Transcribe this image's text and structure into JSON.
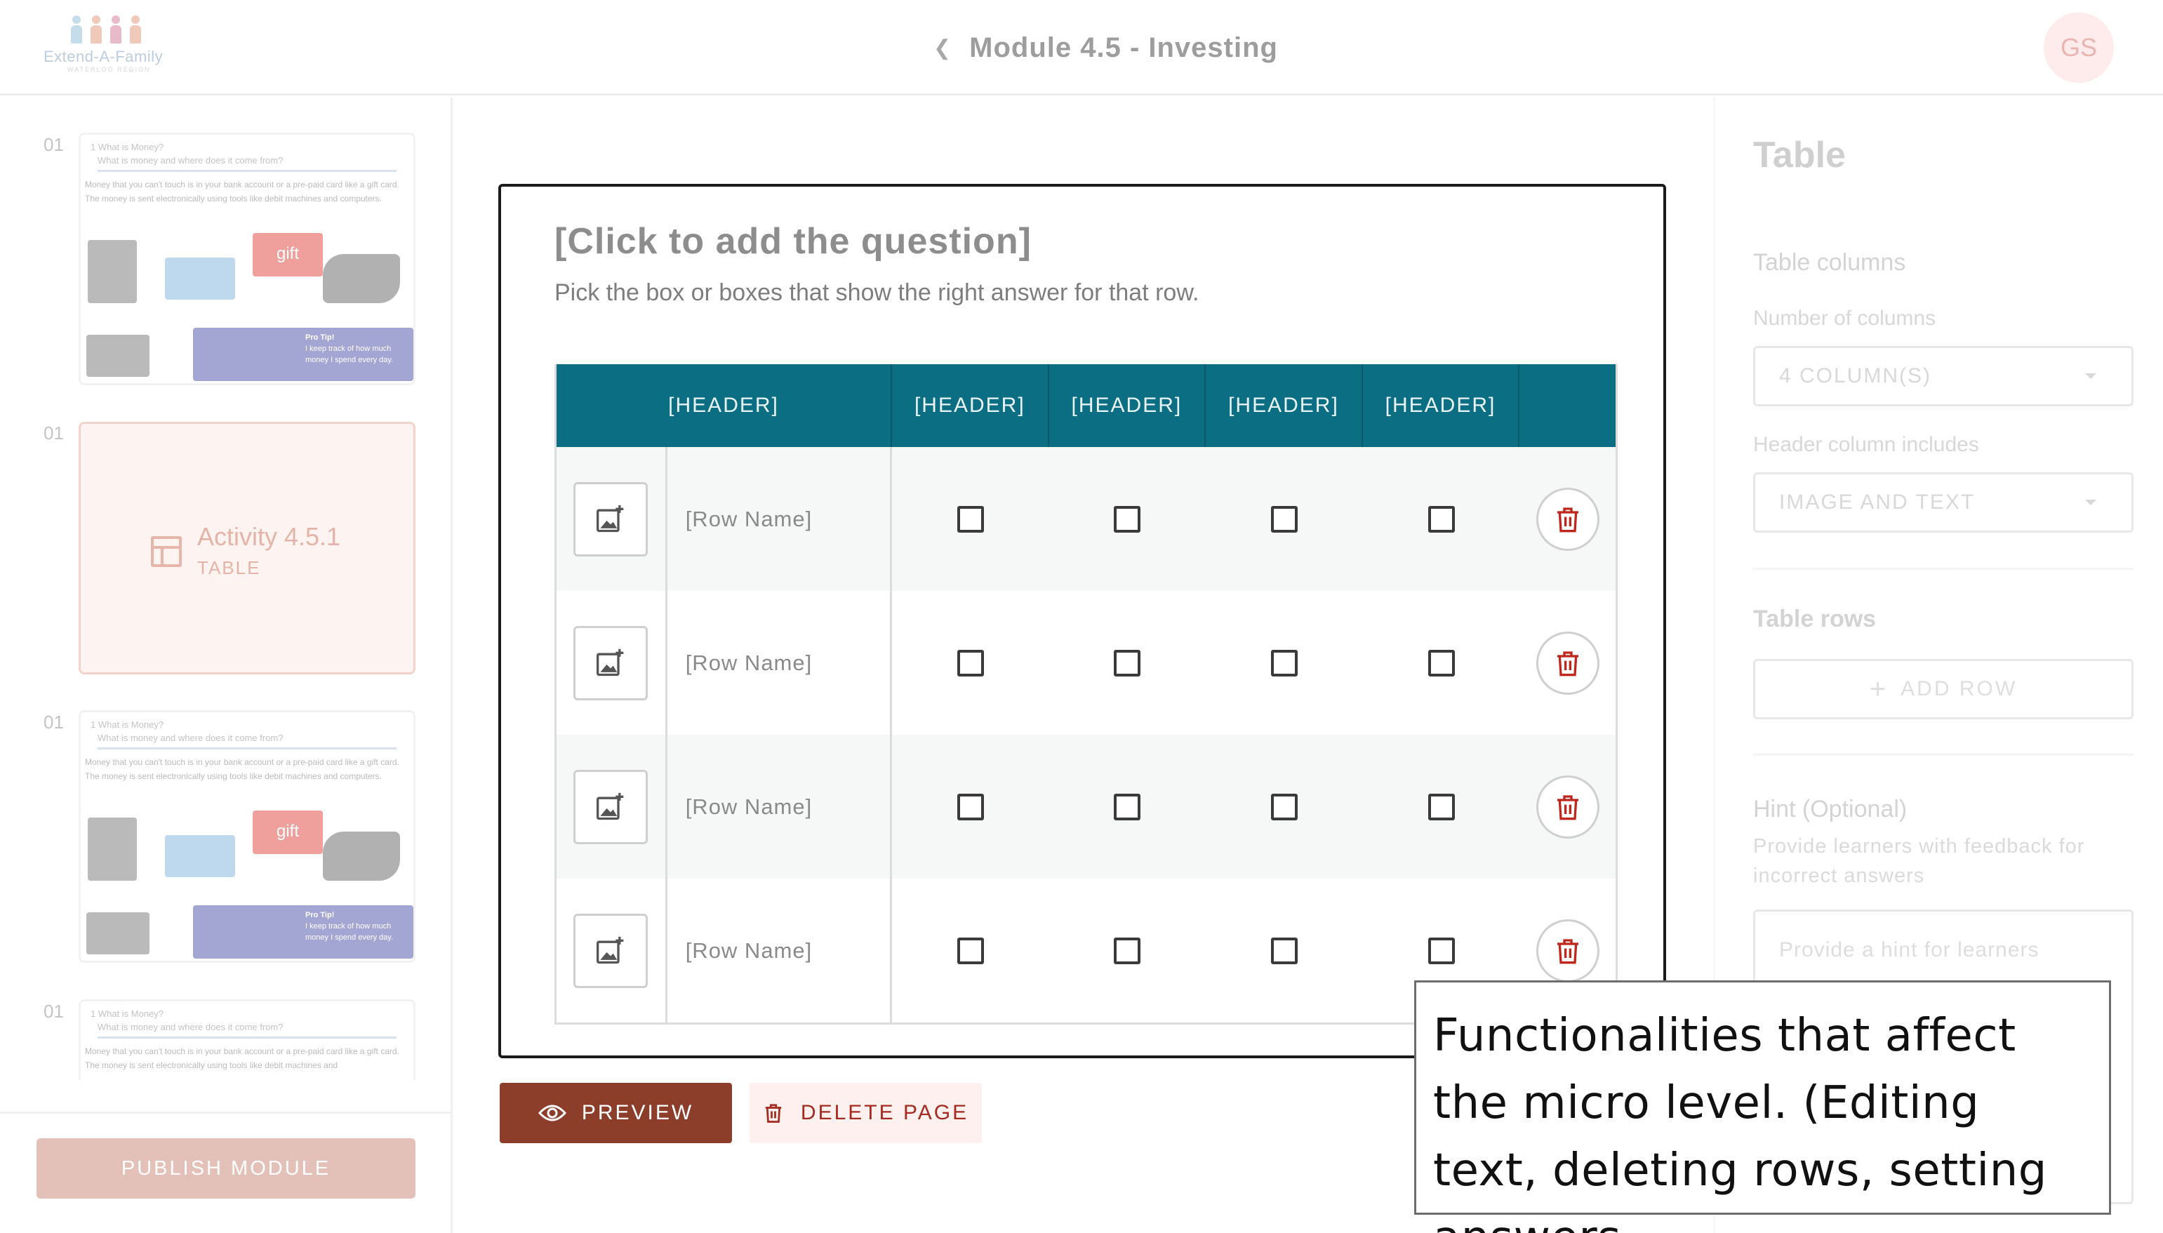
{
  "header": {
    "logo_text": "Extend-A-Family",
    "logo_subtext": "WATERLOO REGION",
    "module_title": "Module 4.5 - Investing",
    "avatar_initials": "GS"
  },
  "sidebar": {
    "slides": [
      {
        "number": "01",
        "kind": "thumbnail",
        "heading": "1 What is Money?",
        "subheading": "What is money and where does it come from?",
        "body": "Money that you can't touch is in your bank account or a pre-paid card like a gift card.  The money is sent electronically using tools like debit machines and computers.",
        "badge": "gift",
        "tip_title": "Pro Tip!",
        "tip_text": "I keep track of how much money I spend every day."
      },
      {
        "number": "01",
        "kind": "activity",
        "title": "Activity 4.5.1",
        "type": "TABLE"
      },
      {
        "number": "01",
        "kind": "thumbnail",
        "heading": "1 What is Money?",
        "subheading": "What is money and where does it come from?",
        "body": "Money that you can't touch is in your bank account or a pre-paid card like a gift card.  The money is sent electronically using tools like debit machines and computers.",
        "badge": "gift",
        "tip_title": "Pro Tip!",
        "tip_text": "I keep track of how much money I spend every day."
      },
      {
        "number": "01",
        "kind": "thumbnail",
        "heading": "1 What is Money?",
        "subheading": "What is money and where does it come from?",
        "body": "Money that you can't touch is in your bank account or a pre-paid card like a gift card.  The money is sent electronically using tools like debit machines and"
      }
    ],
    "publish_label": "PUBLISH MODULE"
  },
  "editor": {
    "question": "[Click to add the question]",
    "instruction": "Pick the box or boxes that show the right answer for that row.",
    "table": {
      "main_header": "[HEADER]",
      "column_headers": [
        "[HEADER]",
        "[HEADER]",
        "[HEADER]",
        "[HEADER]"
      ],
      "rows": [
        {
          "name": "[Row Name]"
        },
        {
          "name": "[Row Name]"
        },
        {
          "name": "[Row Name]"
        },
        {
          "name": "[Row Name]"
        }
      ]
    },
    "preview_label": "PREVIEW",
    "delete_page_label": "DELETE PAGE"
  },
  "right_panel": {
    "title": "Table",
    "columns_section": "Table columns",
    "number_of_columns_label": "Number of columns",
    "number_of_columns_value": "4 COLUMN(S)",
    "header_includes_label": "Header column includes",
    "header_includes_value": "IMAGE AND TEXT",
    "rows_section": "Table rows",
    "add_row_label": "ADD ROW",
    "hint_section": "Hint (Optional)",
    "hint_description": "Provide learners with feedback for incorrect answers",
    "hint_placeholder": "Provide a hint for learners"
  },
  "annotation": {
    "text": "Functionalities that affect the micro level. (Editing text, deleting rows, setting answers."
  },
  "colors": {
    "table_header": "#0b6e82",
    "preview_button": "#8d3e2b",
    "danger": "#a52a20"
  }
}
